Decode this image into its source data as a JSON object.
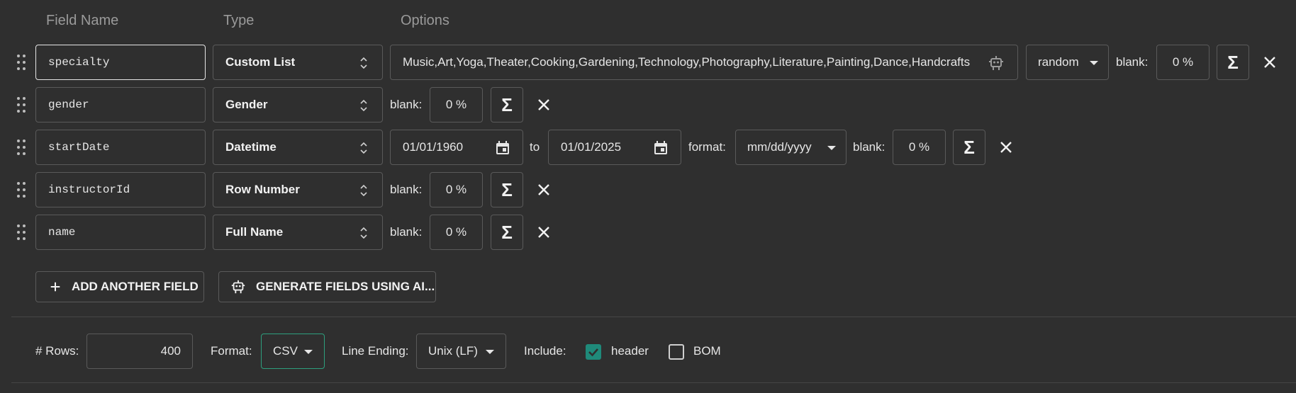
{
  "headers": {
    "field_name": "Field Name",
    "type": "Type",
    "options": "Options"
  },
  "fields": [
    {
      "name": "specialty",
      "type": "Custom List",
      "options_text": "Music,Art,Yoga,Theater,Cooking,Gardening,Technology,Photography,Literature,Painting,Dance,Handcrafts",
      "order": "random",
      "blank_label": "blank:",
      "blank": "0 %"
    },
    {
      "name": "gender",
      "type": "Gender",
      "blank_label": "blank:",
      "blank": "0 %"
    },
    {
      "name": "startDate",
      "type": "Datetime",
      "from": "01/01/1960",
      "to_label": "to",
      "to": "01/01/2025",
      "format_label": "format:",
      "format": "mm/dd/yyyy",
      "blank_label": "blank:",
      "blank": "0 %"
    },
    {
      "name": "instructorId",
      "type": "Row Number",
      "blank_label": "blank:",
      "blank": "0 %"
    },
    {
      "name": "name",
      "type": "Full Name",
      "blank_label": "blank:",
      "blank": "0 %"
    }
  ],
  "actions": {
    "add_field": "ADD ANOTHER FIELD",
    "generate_ai": "GENERATE FIELDS USING AI..."
  },
  "footer": {
    "rows_label": "# Rows:",
    "rows": "400",
    "format_label": "Format:",
    "format": "CSV",
    "line_ending_label": "Line Ending:",
    "line_ending": "Unix (LF)",
    "include_label": "Include:",
    "header_label": "header",
    "header_checked": true,
    "bom_label": "BOM",
    "bom_checked": false
  },
  "colors": {
    "accent_green": "#2e9f7e",
    "check_teal": "#1f8a7a"
  },
  "icons": [
    "drag-handle-icon",
    "updown-icon",
    "robot-icon",
    "sigma-icon",
    "close-icon",
    "calendar-icon",
    "plus-icon",
    "chevron-down-icon",
    "check-icon"
  ]
}
